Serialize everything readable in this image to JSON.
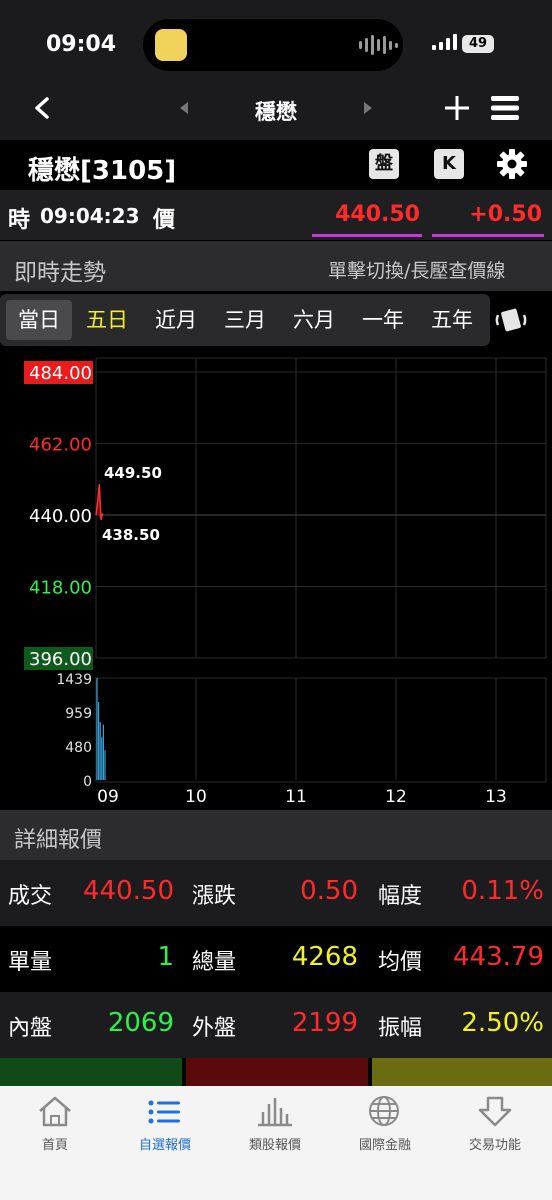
{
  "status": {
    "time": "09:04",
    "battery": "49"
  },
  "nav": {
    "title": "穩懋"
  },
  "stock": {
    "name": "穩懋[3105]",
    "tools": [
      "盤",
      "K"
    ]
  },
  "quote": {
    "time_label": "時",
    "time": "09:04:23",
    "price_label": "價",
    "price": "440.50",
    "change": "+0.50"
  },
  "trend": {
    "title": "即時走勢",
    "hint": "單擊切換/長壓查價線"
  },
  "periods": [
    "當日",
    "五日",
    "近月",
    "三月",
    "六月",
    "一年",
    "五年"
  ],
  "chart_data": {
    "type": "line",
    "price_axis": [
      "484.00",
      "462.00",
      "440.00",
      "418.00",
      "396.00"
    ],
    "ylim": [
      396,
      484
    ],
    "reference": 440.0,
    "annotations": {
      "high": "449.50",
      "low": "438.50"
    },
    "x_ticks": [
      "09",
      "10",
      "11",
      "12",
      "13"
    ],
    "price_series": [
      {
        "t": "09:00",
        "y": 440.0
      },
      {
        "t": "09:01",
        "y": 444.0
      },
      {
        "t": "09:02",
        "y": 449.5
      },
      {
        "t": "09:03",
        "y": 438.5
      },
      {
        "t": "09:04",
        "y": 440.5
      }
    ],
    "volume_axis": [
      "1439",
      "959",
      "480",
      "0"
    ],
    "volume_max": 1439,
    "volume_series": [
      1439,
      1100,
      820,
      600,
      780,
      420
    ]
  },
  "detail": {
    "title": "詳細報價",
    "rows": [
      [
        {
          "label": "成交",
          "value": "440.50",
          "color": "#ff2b2b"
        },
        {
          "label": "漲跌",
          "value": "0.50",
          "color": "#ff2b2b"
        },
        {
          "label": "幅度",
          "value": "0.11%",
          "color": "#ff2b2b"
        }
      ],
      [
        {
          "label": "單量",
          "value": "1",
          "color": "#2cf24b"
        },
        {
          "label": "總量",
          "value": "4268",
          "color": "#f2f21e"
        },
        {
          "label": "均價",
          "value": "443.79",
          "color": "#ff2b2b"
        }
      ],
      [
        {
          "label": "內盤",
          "value": "2069",
          "color": "#2cf24b"
        },
        {
          "label": "外盤",
          "value": "2199",
          "color": "#ff2b2b"
        },
        {
          "label": "振幅",
          "value": "2.50%",
          "color": "#f2f21e"
        }
      ]
    ]
  },
  "tabbar": {
    "items": [
      "首頁",
      "自選報價",
      "類股報價",
      "國際金融",
      "交易功能"
    ],
    "active": 1
  }
}
